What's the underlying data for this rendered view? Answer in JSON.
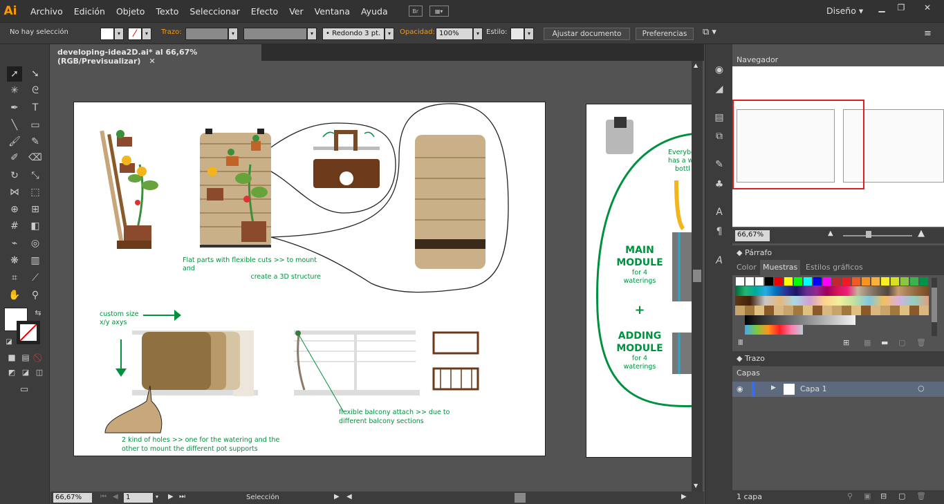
{
  "app": {
    "logo": "Ai",
    "menu": [
      "Archivo",
      "Edición",
      "Objeto",
      "Texto",
      "Seleccionar",
      "Efecto",
      "Ver",
      "Ventana",
      "Ayuda"
    ],
    "bridge": "Br",
    "workspace": "Diseño"
  },
  "control": {
    "selection": "No hay selección",
    "stroke_label": "Trazo:",
    "brush": "Redondo 3 pt.",
    "opacity_label": "Opacidad:",
    "opacity": "100%",
    "style_label": "Estilo:",
    "adjust_doc": "Ajustar documento",
    "prefs": "Preferencias"
  },
  "document": {
    "tab_title": "developing-idea2D.ai* al 66,67% (RGB/Previsualizar)",
    "zoom": "66,67%",
    "page": "1",
    "status": "Selección"
  },
  "artboard": {
    "caption_flat": "Flat parts with flexible cuts >> to mount and create a 3D structure",
    "caption_flat_1": "Flat parts with flexible cuts >> to mount and",
    "caption_flat_2": "create a 3D structure",
    "custom_size_1": "custom size",
    "custom_size_2": "x/y axys",
    "holes_1": "2 kind of holes  >> one for the watering and the",
    "holes_2": "other to mount the different pot supports",
    "balcony_1": "flexible balcony attach >> due to",
    "balcony_2": "different balcony sections"
  },
  "artboard2": {
    "main": "MAIN",
    "module": "MODULE",
    "for4": "for 4",
    "waterings": "waterings",
    "plus": "+",
    "adding": "ADDING",
    "module2": "MODULE",
    "for4b": "for 4",
    "waterings2": "waterings",
    "everybo": "Everybo",
    "hasa": "has a wa",
    "bottl": "bottl"
  },
  "panels": {
    "navigator": "Navegador",
    "nav_zoom": "66,67%",
    "paragraph": "Párrafo",
    "color_tab": "Color",
    "swatches_tab": "Muestras",
    "graphic_styles_tab": "Estilos gráficos",
    "stroke": "Trazo",
    "layers": "Capas",
    "layer_name": "Capa 1",
    "layer_count": "1 capa"
  },
  "colors": {
    "accent_green": "#00913f",
    "orange": "#f39a21",
    "nav_red": "#e02020"
  }
}
